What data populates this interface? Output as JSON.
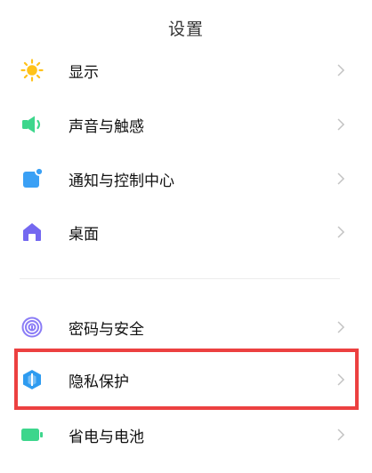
{
  "header": {
    "title": "设置"
  },
  "settings": {
    "items": [
      {
        "label": "显示",
        "icon": "sun-icon",
        "color": "#FFC21A"
      },
      {
        "label": "声音与触感",
        "icon": "speaker-icon",
        "color": "#3DD68C"
      },
      {
        "label": "通知与控制中心",
        "icon": "notification-icon",
        "color": "#3AA0F5"
      },
      {
        "label": "桌面",
        "icon": "home-icon",
        "color": "#7468F0"
      },
      {
        "label": "密码与安全",
        "icon": "fingerprint-icon",
        "color": "#8A7CF6"
      },
      {
        "label": "隐私保护",
        "icon": "privacy-shield-icon",
        "color": "#2E9BF0"
      },
      {
        "label": "省电与电池",
        "icon": "battery-icon",
        "color": "#3DD68C"
      }
    ]
  },
  "highlight": {
    "target": "隐私保护",
    "color": "#EC4040"
  }
}
